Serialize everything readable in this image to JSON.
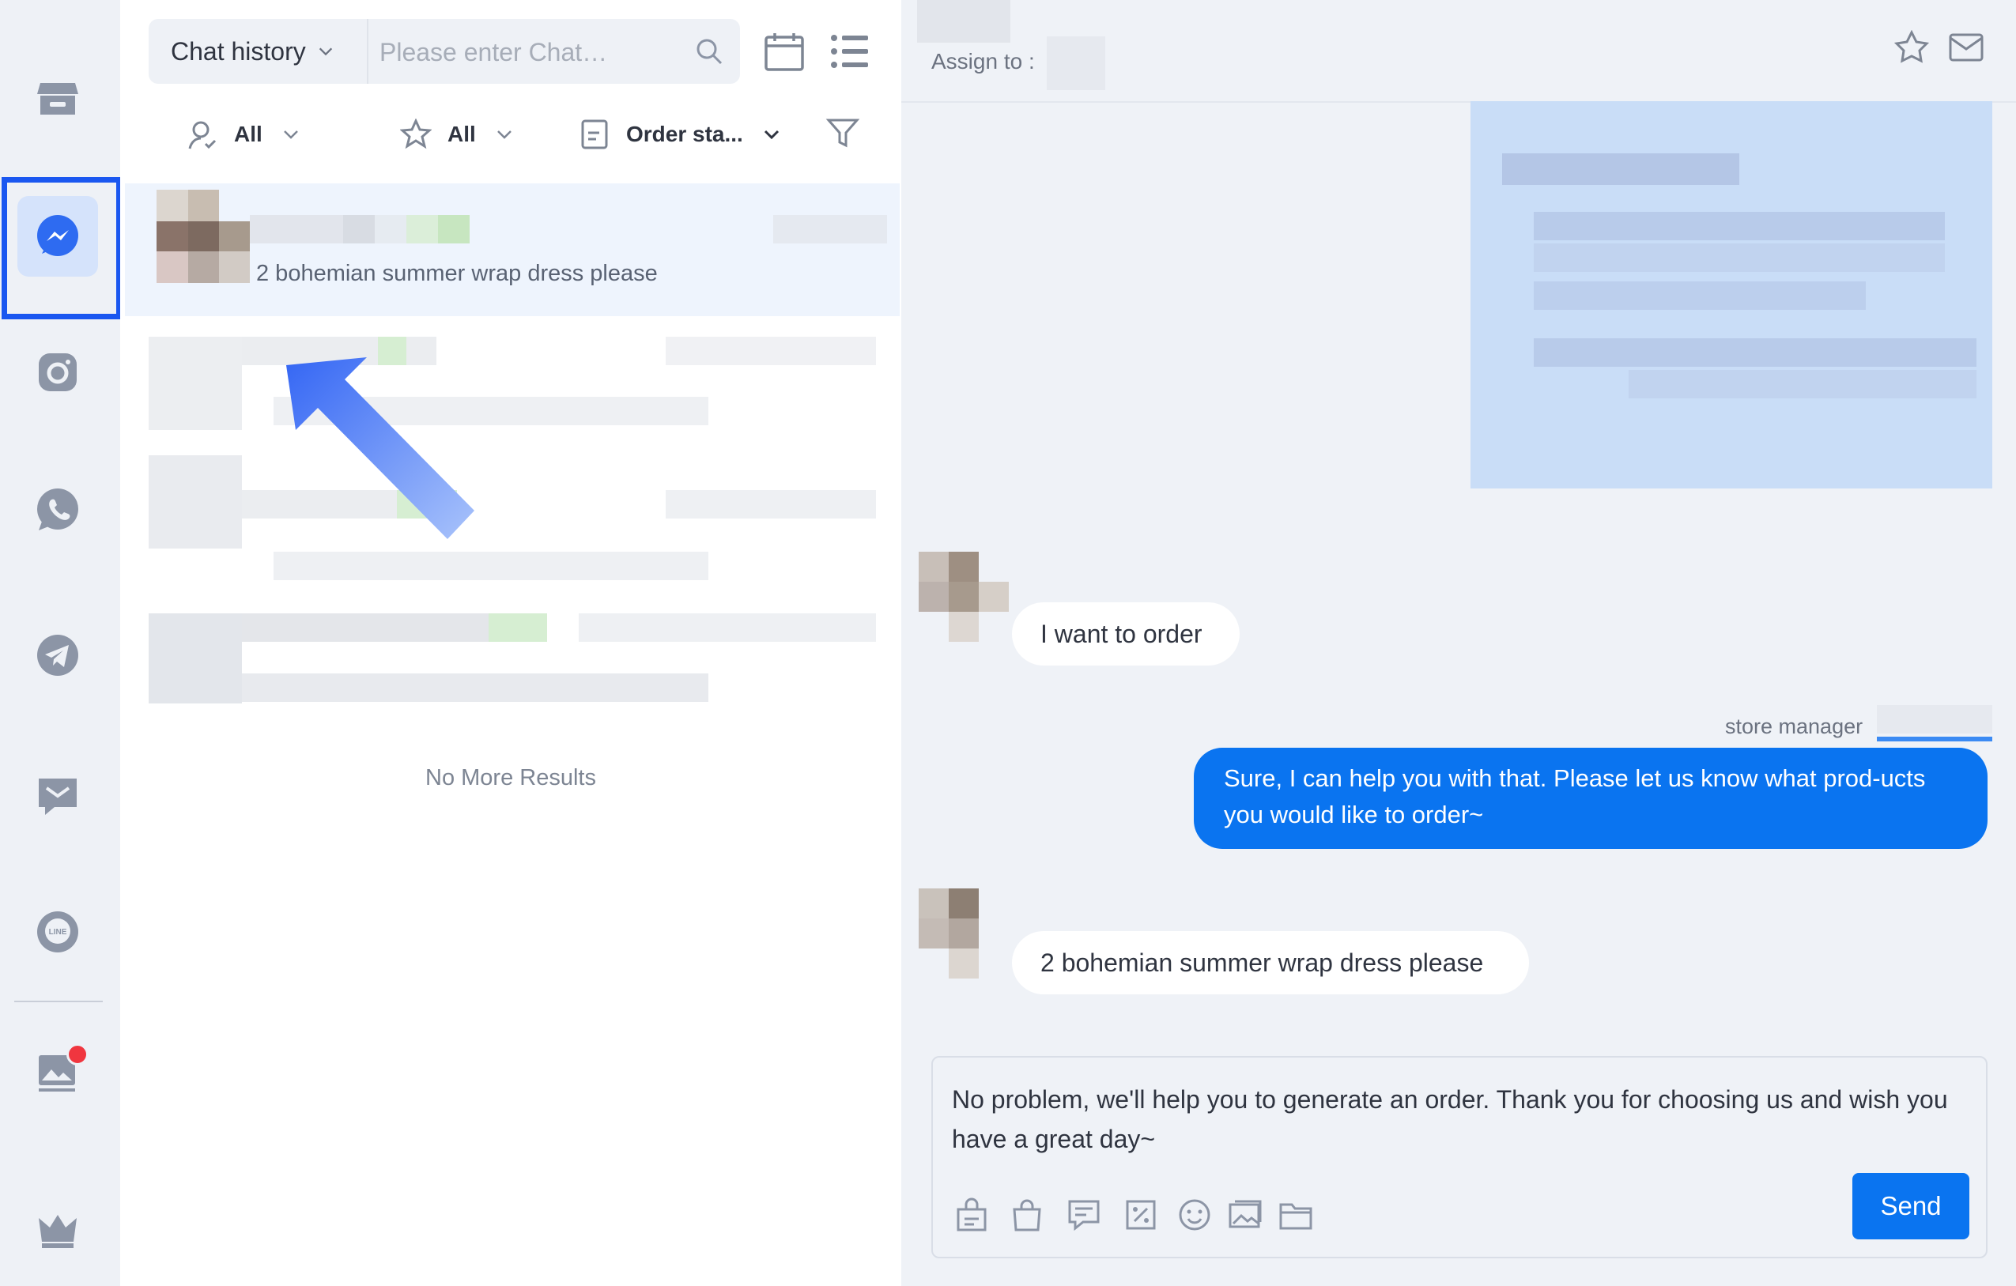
{
  "sidebar": {
    "items": [
      {
        "name": "store-icon"
      },
      {
        "name": "messenger-icon",
        "active": true
      },
      {
        "name": "instagram-icon"
      },
      {
        "name": "whatsapp-icon"
      },
      {
        "name": "telegram-icon"
      },
      {
        "name": "sms-icon"
      },
      {
        "name": "line-icon",
        "text": "LINE"
      },
      {
        "name": "gallery-icon",
        "has_notification": true
      },
      {
        "name": "crown-icon"
      }
    ]
  },
  "chat_list": {
    "history_select": "Chat history",
    "search_placeholder": "Please enter Chat…",
    "filters": {
      "agent": "All",
      "starred": "All",
      "order_status": "Order sta..."
    },
    "active_preview": "2 bohemian summer wrap dress please",
    "no_more": "No More Results"
  },
  "conversation": {
    "assign_label": "Assign to :",
    "messages": [
      {
        "direction": "in",
        "text": "I want to order"
      },
      {
        "direction": "out",
        "sender": "store manager",
        "text": "Sure, I can help you with that. Please let us know what prod-ucts you would like to order~"
      },
      {
        "direction": "in",
        "text": "2 bohemian summer wrap dress please"
      }
    ],
    "composer_text": "No problem, we'll help you to generate an order. Thank you for choosing us and wish you have a great day~",
    "send_label": "Send"
  },
  "colors": {
    "accent": "#0a74f0",
    "highlight_border": "#1a57f0",
    "rail_bg": "#eef1f6",
    "icon_gray": "#8c95a6",
    "messenger_blue": "#2e6bf1"
  }
}
